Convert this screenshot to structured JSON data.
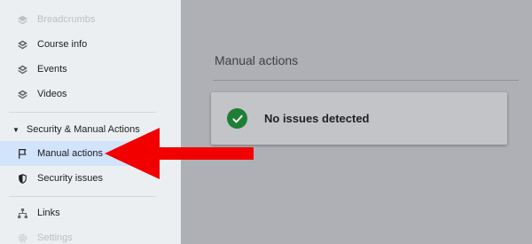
{
  "sidebar": {
    "items_top": [
      {
        "label": "Breadcrumbs",
        "icon": "layers-icon"
      },
      {
        "label": "Course info",
        "icon": "layers-icon"
      },
      {
        "label": "Events",
        "icon": "layers-icon"
      },
      {
        "label": "Videos",
        "icon": "layers-icon"
      }
    ],
    "section": {
      "label": "Security & Manual Actions",
      "icon": "caret-down-icon"
    },
    "section_items": [
      {
        "label": "Manual actions",
        "icon": "flag-icon"
      },
      {
        "label": "Security issues",
        "icon": "shield-icon"
      }
    ],
    "items_bottom": [
      {
        "label": "Links",
        "icon": "sitemap-icon"
      },
      {
        "label": "Settings",
        "icon": "gear-icon"
      }
    ]
  },
  "main": {
    "title": "Manual actions",
    "status_message": "No issues detected",
    "status_icon": "check-circle-icon"
  },
  "colors": {
    "active_bg": "#d2e3fc",
    "success": "#1e7e34",
    "annotation_arrow": "#ff0000"
  }
}
